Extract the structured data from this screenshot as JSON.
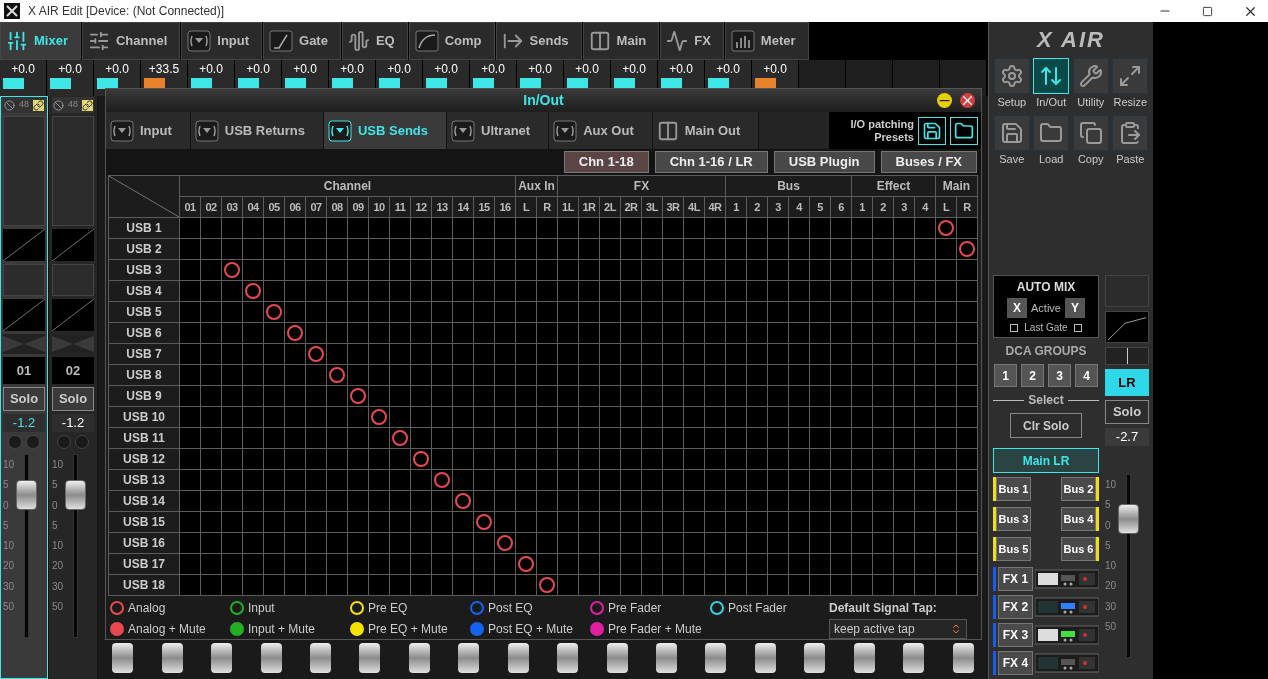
{
  "window": {
    "title": "X AIR Edit [Device: (Not Connected)]"
  },
  "tabs": [
    {
      "label": "Mixer",
      "selected": true
    },
    {
      "label": "Channel",
      "selected": false
    },
    {
      "label": "Input",
      "selected": false
    },
    {
      "label": "Gate",
      "selected": false
    },
    {
      "label": "EQ",
      "selected": false
    },
    {
      "label": "Comp",
      "selected": false
    },
    {
      "label": "Sends",
      "selected": false
    },
    {
      "label": "Main",
      "selected": false
    },
    {
      "label": "FX",
      "selected": false
    },
    {
      "label": "Meter",
      "selected": false
    }
  ],
  "channel_values": [
    {
      "value": "+0.0",
      "color": "#3ee6e6"
    },
    {
      "value": "+0.0",
      "color": "#3ee6e6"
    },
    {
      "value": "+0.0",
      "color": "#3ee6e6"
    },
    {
      "value": "+33.5",
      "color": "#e8822a"
    },
    {
      "value": "+0.0",
      "color": "#3ee6e6"
    },
    {
      "value": "+0.0",
      "color": "#3ee6e6"
    },
    {
      "value": "+0.0",
      "color": "#3ee6e6"
    },
    {
      "value": "+0.0",
      "color": "#3ee6e6"
    },
    {
      "value": "+0.0",
      "color": "#3ee6e6"
    },
    {
      "value": "+0.0",
      "color": "#3ee6e6"
    },
    {
      "value": "+0.0",
      "color": "#3ee6e6"
    },
    {
      "value": "+0.0",
      "color": "#3ee6e6"
    },
    {
      "value": "+0.0",
      "color": "#3ee6e6"
    },
    {
      "value": "+0.0",
      "color": "#3ee6e6"
    },
    {
      "value": "+0.0",
      "color": "#3ee6e6"
    },
    {
      "value": "+0.0",
      "color": "#3ee6e6"
    },
    {
      "value": "+0.0",
      "color": "#e8822a"
    }
  ],
  "strips": [
    {
      "phantom": "48",
      "name": "01",
      "solo": "Solo",
      "gain": "-1.2",
      "selected": true,
      "level": 0.78,
      "scale": [
        "10",
        "5",
        "0",
        "5",
        "10",
        "20",
        "30",
        "50"
      ]
    },
    {
      "phantom": "48",
      "name": "02",
      "solo": "Solo",
      "gain": "-1.2",
      "selected": false,
      "level": 0.78,
      "scale": [
        "10",
        "5",
        "0",
        "5",
        "10",
        "20",
        "30",
        "50"
      ]
    }
  ],
  "panel": {
    "logo": "X AIR",
    "tools": [
      {
        "label": "Setup",
        "selected": false
      },
      {
        "label": "In/Out",
        "selected": true
      },
      {
        "label": "Utility",
        "selected": false
      },
      {
        "label": "Resize",
        "selected": false
      },
      {
        "label": "Save",
        "selected": false
      },
      {
        "label": "Load",
        "selected": false
      },
      {
        "label": "Copy",
        "selected": false
      },
      {
        "label": "Paste",
        "selected": false
      }
    ],
    "automix": {
      "title": "AUTO MIX",
      "x": "X",
      "active": "Active",
      "y": "Y",
      "last_gate": "Last Gate",
      "left_checked": false,
      "right_checked": false
    },
    "dca": {
      "title": "DCA GROUPS",
      "buttons": [
        "1",
        "2",
        "3",
        "4"
      ],
      "select": "Select"
    },
    "clr_solo": "Clr Solo",
    "main_lr": {
      "label": "Main LR",
      "selected": true
    },
    "buses": [
      {
        "label": "Bus 1",
        "color": "#f0e010"
      },
      {
        "label": "Bus 2",
        "color": "#f0e010"
      },
      {
        "label": "Bus 3",
        "color": "#f0e010"
      },
      {
        "label": "Bus 4",
        "color": "#f0e010"
      },
      {
        "label": "Bus 5",
        "color": "#f0e010"
      },
      {
        "label": "Bus 6",
        "color": "#f0e010"
      }
    ],
    "fx": [
      {
        "label": "FX 1",
        "color": "#1a5cf0"
      },
      {
        "label": "FX 2",
        "color": "#1a5cf0"
      },
      {
        "label": "FX 3",
        "color": "#1a5cf0"
      },
      {
        "label": "FX 4",
        "color": "#1a5cf0"
      }
    ],
    "main_strip": {
      "name": "LR",
      "selected": true,
      "solo": "Solo",
      "gain": "-2.7",
      "level": 0.76,
      "scale": [
        "10",
        "5",
        "0",
        "5",
        "10",
        "20",
        "30",
        "50"
      ]
    }
  },
  "dialog": {
    "title": "In/Out",
    "tabs": [
      {
        "label": "Input",
        "selected": false
      },
      {
        "label": "USB Returns",
        "selected": false
      },
      {
        "label": "USB Sends",
        "selected": true
      },
      {
        "label": "Ultranet",
        "selected": false
      },
      {
        "label": "Aux Out",
        "selected": false
      },
      {
        "label": "Main Out",
        "selected": false
      }
    ],
    "presets": "I/O patching Presets",
    "banks": [
      {
        "label": "Chn 1-18",
        "selected": true
      },
      {
        "label": "Chn 1-16 / LR",
        "selected": false
      },
      {
        "label": "USB Plugin",
        "selected": false
      },
      {
        "label": "Buses / FX",
        "selected": false
      }
    ],
    "grid": {
      "groups": [
        {
          "label": "Channel",
          "columns": [
            "01",
            "02",
            "03",
            "04",
            "05",
            "06",
            "07",
            "08",
            "09",
            "10",
            "11",
            "12",
            "13",
            "14",
            "15",
            "16"
          ]
        },
        {
          "label": "Aux In",
          "columns": [
            "L",
            "R"
          ]
        },
        {
          "label": "FX",
          "columns": [
            "1L",
            "1R",
            "2L",
            "2R",
            "3L",
            "3R",
            "4L",
            "4R"
          ]
        },
        {
          "label": "Bus",
          "columns": [
            "1",
            "2",
            "3",
            "4",
            "5",
            "6"
          ]
        },
        {
          "label": "Effect",
          "columns": [
            "1",
            "2",
            "3",
            "4"
          ]
        },
        {
          "label": "Main",
          "columns": [
            "L",
            "R"
          ]
        }
      ],
      "rows": [
        {
          "label": "USB 1",
          "color": "#e8484f",
          "cells": [
            false,
            false,
            false,
            false,
            false,
            false,
            false,
            false,
            false,
            false,
            false,
            false,
            false,
            false,
            false,
            false,
            false,
            false,
            false,
            false,
            false,
            false,
            false,
            false,
            false,
            false,
            false,
            false,
            false,
            false,
            false,
            false,
            false,
            false,
            false,
            false,
            true,
            false
          ]
        },
        {
          "label": "USB 2",
          "color": "#e8484f",
          "cells": [
            false,
            false,
            false,
            false,
            false,
            false,
            false,
            false,
            false,
            false,
            false,
            false,
            false,
            false,
            false,
            false,
            false,
            false,
            false,
            false,
            false,
            false,
            false,
            false,
            false,
            false,
            false,
            false,
            false,
            false,
            false,
            false,
            false,
            false,
            false,
            false,
            false,
            true
          ]
        },
        {
          "label": "USB 3",
          "color": "#e8484f",
          "cells": [
            false,
            false,
            true,
            false,
            false,
            false,
            false,
            false,
            false,
            false,
            false,
            false,
            false,
            false,
            false,
            false,
            false,
            false,
            false,
            false,
            false,
            false,
            false,
            false,
            false,
            false,
            false,
            false,
            false,
            false,
            false,
            false,
            false,
            false,
            false,
            false,
            false,
            false
          ]
        },
        {
          "label": "USB 4",
          "color": "#e8484f",
          "cells": [
            false,
            false,
            false,
            true,
            false,
            false,
            false,
            false,
            false,
            false,
            false,
            false,
            false,
            false,
            false,
            false,
            false,
            false,
            false,
            false,
            false,
            false,
            false,
            false,
            false,
            false,
            false,
            false,
            false,
            false,
            false,
            false,
            false,
            false,
            false,
            false,
            false,
            false
          ]
        },
        {
          "label": "USB 5",
          "color": "#e8484f",
          "cells": [
            false,
            false,
            false,
            false,
            true,
            false,
            false,
            false,
            false,
            false,
            false,
            false,
            false,
            false,
            false,
            false,
            false,
            false,
            false,
            false,
            false,
            false,
            false,
            false,
            false,
            false,
            false,
            false,
            false,
            false,
            false,
            false,
            false,
            false,
            false,
            false,
            false,
            false
          ]
        },
        {
          "label": "USB 6",
          "color": "#e8484f",
          "cells": [
            false,
            false,
            false,
            false,
            false,
            true,
            false,
            false,
            false,
            false,
            false,
            false,
            false,
            false,
            false,
            false,
            false,
            false,
            false,
            false,
            false,
            false,
            false,
            false,
            false,
            false,
            false,
            false,
            false,
            false,
            false,
            false,
            false,
            false,
            false,
            false,
            false,
            false
          ]
        },
        {
          "label": "USB 7",
          "color": "#e8484f",
          "cells": [
            false,
            false,
            false,
            false,
            false,
            false,
            true,
            false,
            false,
            false,
            false,
            false,
            false,
            false,
            false,
            false,
            false,
            false,
            false,
            false,
            false,
            false,
            false,
            false,
            false,
            false,
            false,
            false,
            false,
            false,
            false,
            false,
            false,
            false,
            false,
            false,
            false,
            false
          ]
        },
        {
          "label": "USB 8",
          "color": "#e8484f",
          "cells": [
            false,
            false,
            false,
            false,
            false,
            false,
            false,
            true,
            false,
            false,
            false,
            false,
            false,
            false,
            false,
            false,
            false,
            false,
            false,
            false,
            false,
            false,
            false,
            false,
            false,
            false,
            false,
            false,
            false,
            false,
            false,
            false,
            false,
            false,
            false,
            false,
            false,
            false
          ]
        },
        {
          "label": "USB 9",
          "color": "#e8484f",
          "cells": [
            false,
            false,
            false,
            false,
            false,
            false,
            false,
            false,
            true,
            false,
            false,
            false,
            false,
            false,
            false,
            false,
            false,
            false,
            false,
            false,
            false,
            false,
            false,
            false,
            false,
            false,
            false,
            false,
            false,
            false,
            false,
            false,
            false,
            false,
            false,
            false,
            false,
            false
          ]
        },
        {
          "label": "USB 10",
          "color": "#e8484f",
          "cells": [
            false,
            false,
            false,
            false,
            false,
            false,
            false,
            false,
            false,
            true,
            false,
            false,
            false,
            false,
            false,
            false,
            false,
            false,
            false,
            false,
            false,
            false,
            false,
            false,
            false,
            false,
            false,
            false,
            false,
            false,
            false,
            false,
            false,
            false,
            false,
            false,
            false,
            false
          ]
        },
        {
          "label": "USB 11",
          "color": "#e8484f",
          "cells": [
            false,
            false,
            false,
            false,
            false,
            false,
            false,
            false,
            false,
            false,
            true,
            false,
            false,
            false,
            false,
            false,
            false,
            false,
            false,
            false,
            false,
            false,
            false,
            false,
            false,
            false,
            false,
            false,
            false,
            false,
            false,
            false,
            false,
            false,
            false,
            false,
            false,
            false
          ]
        },
        {
          "label": "USB 12",
          "color": "#e8484f",
          "cells": [
            false,
            false,
            false,
            false,
            false,
            false,
            false,
            false,
            false,
            false,
            false,
            true,
            false,
            false,
            false,
            false,
            false,
            false,
            false,
            false,
            false,
            false,
            false,
            false,
            false,
            false,
            false,
            false,
            false,
            false,
            false,
            false,
            false,
            false,
            false,
            false,
            false,
            false
          ]
        },
        {
          "label": "USB 13",
          "color": "#e8484f",
          "cells": [
            false,
            false,
            false,
            false,
            false,
            false,
            false,
            false,
            false,
            false,
            false,
            false,
            true,
            false,
            false,
            false,
            false,
            false,
            false,
            false,
            false,
            false,
            false,
            false,
            false,
            false,
            false,
            false,
            false,
            false,
            false,
            false,
            false,
            false,
            false,
            false,
            false,
            false
          ]
        },
        {
          "label": "USB 14",
          "color": "#e8484f",
          "cells": [
            false,
            false,
            false,
            false,
            false,
            false,
            false,
            false,
            false,
            false,
            false,
            false,
            false,
            true,
            false,
            false,
            false,
            false,
            false,
            false,
            false,
            false,
            false,
            false,
            false,
            false,
            false,
            false,
            false,
            false,
            false,
            false,
            false,
            false,
            false,
            false,
            false,
            false
          ]
        },
        {
          "label": "USB 15",
          "color": "#e8484f",
          "cells": [
            false,
            false,
            false,
            false,
            false,
            false,
            false,
            false,
            false,
            false,
            false,
            false,
            false,
            false,
            true,
            false,
            false,
            false,
            false,
            false,
            false,
            false,
            false,
            false,
            false,
            false,
            false,
            false,
            false,
            false,
            false,
            false,
            false,
            false,
            false,
            false,
            false,
            false
          ]
        },
        {
          "label": "USB 16",
          "color": "#e8484f",
          "cells": [
            false,
            false,
            false,
            false,
            false,
            false,
            false,
            false,
            false,
            false,
            false,
            false,
            false,
            false,
            false,
            true,
            false,
            false,
            false,
            false,
            false,
            false,
            false,
            false,
            false,
            false,
            false,
            false,
            false,
            false,
            false,
            false,
            false,
            false,
            false,
            false,
            false,
            false
          ]
        },
        {
          "label": "USB 17",
          "color": "#e8484f",
          "cells": [
            false,
            false,
            false,
            false,
            false,
            false,
            false,
            false,
            false,
            false,
            false,
            false,
            false,
            false,
            false,
            false,
            true,
            false,
            false,
            false,
            false,
            false,
            false,
            false,
            false,
            false,
            false,
            false,
            false,
            false,
            false,
            false,
            false,
            false,
            false,
            false,
            false,
            false
          ]
        },
        {
          "label": "USB 18",
          "color": "#e8484f",
          "cells": [
            false,
            false,
            false,
            false,
            false,
            false,
            false,
            false,
            false,
            false,
            false,
            false,
            false,
            false,
            false,
            false,
            false,
            true,
            false,
            false,
            false,
            false,
            false,
            false,
            false,
            false,
            false,
            false,
            false,
            false,
            false,
            false,
            false,
            false,
            false,
            false,
            false,
            false
          ]
        }
      ]
    },
    "legend": [
      {
        "label": "Analog",
        "color": "#e8484f",
        "mute": false
      },
      {
        "label": "Analog + Mute",
        "color": "#e8484f",
        "mute": true
      },
      {
        "label": "Input",
        "color": "#22b022",
        "mute": false
      },
      {
        "label": "Input + Mute",
        "color": "#22b022",
        "mute": true
      },
      {
        "label": "Pre EQ",
        "color": "#f2e400",
        "mute": false
      },
      {
        "label": "Pre EQ + Mute",
        "color": "#f2e400",
        "mute": true
      },
      {
        "label": "Post EQ",
        "color": "#1462f0",
        "mute": false
      },
      {
        "label": "Post EQ + Mute",
        "color": "#1462f0",
        "mute": true
      },
      {
        "label": "Pre Fader",
        "color": "#e020a0",
        "mute": false
      },
      {
        "label": "Pre Fader + Mute",
        "color": "#e020a0",
        "mute": true
      },
      {
        "label": "Post Fader",
        "color": "#30d0e0",
        "mute": false
      }
    ],
    "signal_tap": {
      "label": "Default Signal Tap:",
      "value": "keep active tap"
    }
  }
}
